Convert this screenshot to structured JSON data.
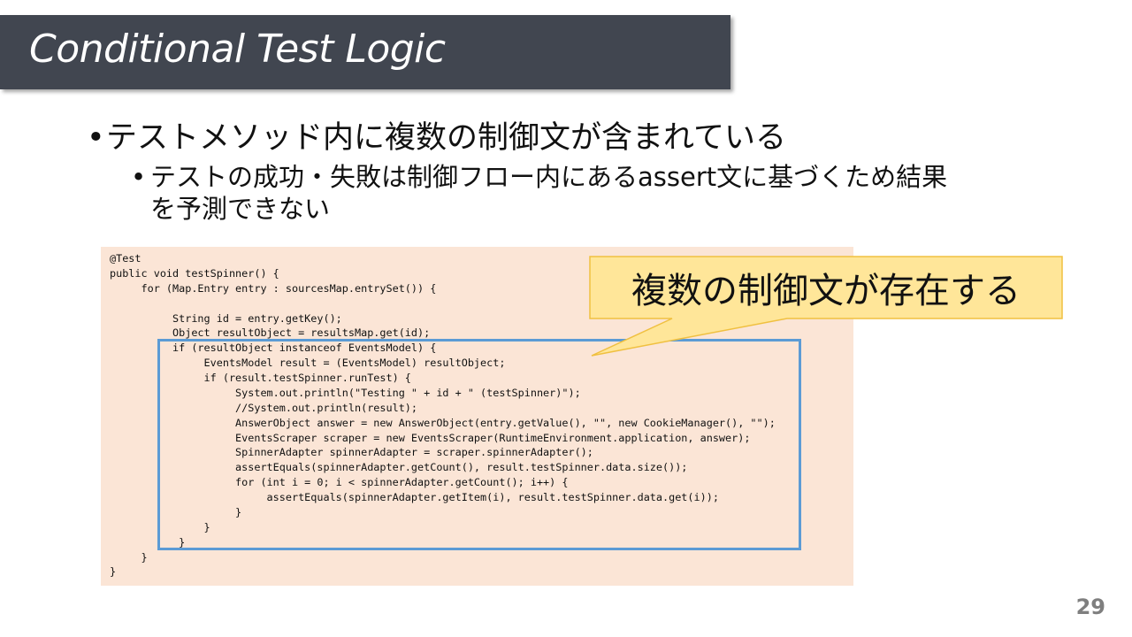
{
  "slide": {
    "title": "Conditional Test Logic",
    "bullet1": "テストメソッド内に複数の制御文が含まれている",
    "bullet2_line1": "テストの成功・失敗は制御フロー内にあるassert文に基づくため結果",
    "bullet2_line2": "を予測できない",
    "callout": "複数の制御文が存在する",
    "page_number": "29"
  },
  "code": [
    "@Test",
    "public void testSpinner() {",
    "     for (Map.Entry entry : sourcesMap.entrySet()) {",
    "",
    "          String id = entry.getKey();",
    "          Object resultObject = resultsMap.get(id);",
    "          if (resultObject instanceof EventsModel) {",
    "               EventsModel result = (EventsModel) resultObject;",
    "               if (result.testSpinner.runTest) {",
    "                    System.out.println(\"Testing \" + id + \" (testSpinner)\");",
    "                    //System.out.println(result);",
    "                    AnswerObject answer = new AnswerObject(entry.getValue(), \"\", new CookieManager(), \"\");",
    "                    EventsScraper scraper = new EventsScraper(RuntimeEnvironment.application, answer);",
    "                    SpinnerAdapter spinnerAdapter = scraper.spinnerAdapter();",
    "                    assertEquals(spinnerAdapter.getCount(), result.testSpinner.data.size());",
    "                    for (int i = 0; i < spinnerAdapter.getCount(); i++) {",
    "                         assertEquals(spinnerAdapter.getItem(i), result.testSpinner.data.get(i));",
    "                    }",
    "               }",
    "           }",
    "     }",
    "}"
  ],
  "colors": {
    "title_bar": "#414650",
    "code_background": "#fbe5d6",
    "highlight_border": "#5b9bd5",
    "callout_fill": "#ffe699",
    "callout_border": "#f0c040"
  }
}
